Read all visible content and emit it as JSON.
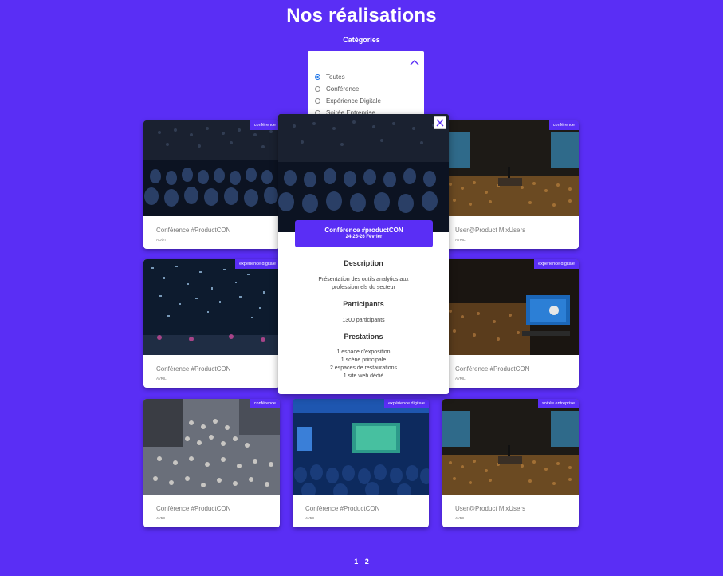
{
  "page": {
    "title": "Nos réalisations"
  },
  "filters": {
    "label": "Catégories",
    "options": [
      "Toutes",
      "Conférence",
      "Expérience Digitale",
      "Soirée Entreprise"
    ],
    "selected": "Toutes"
  },
  "cards": [
    {
      "badge": "conférence",
      "title": "Conférence #ProductCON",
      "month": "AOÛT"
    },
    {
      "badge": "conférence",
      "title": "User@Product MixUsers",
      "month": "AVRIL"
    },
    {
      "badge": "expérience digitale",
      "title": "Conférence #ProductCON",
      "month": "AVRIL"
    },
    {
      "badge": "expérience digitale",
      "title": "Conférence #ProductCON",
      "month": "AVRIL"
    },
    {
      "badge": "conférence",
      "title": "Conférence #ProductCON",
      "month": "AVRIL"
    },
    {
      "badge": "expérience digitale",
      "title": "Conférence #ProductCON",
      "month": "AVRIL"
    },
    {
      "badge": "soirée entreprise",
      "title": "User@Product MixUsers",
      "month": "AVRIL"
    }
  ],
  "modal": {
    "title": "Conférence #productCON",
    "dates": "24-25-26 Février",
    "description_heading": "Description",
    "description": [
      "Présentation des outils analytics aux",
      "professionnels du secteur"
    ],
    "participants_heading": "Participants",
    "participants": "1300 participants",
    "prestations_heading": "Prestations",
    "prestations": [
      "1 espace d'exposition",
      "1 scène principale",
      "2 espaces de restaurations",
      "1 site web dédié"
    ]
  },
  "pagination": {
    "pages": [
      "1",
      "2"
    ],
    "current": "1"
  },
  "colors": {
    "background": "#5a2ef5",
    "accent": "#5a2ef5",
    "radio": "#1a73e8"
  }
}
